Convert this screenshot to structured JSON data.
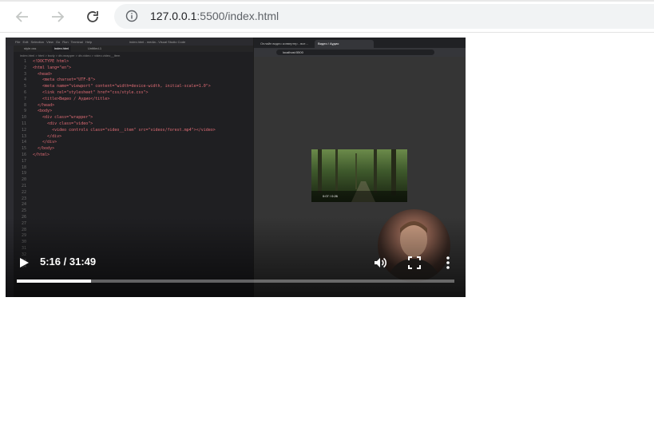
{
  "browser": {
    "url_host": "127.0.0.1",
    "url_rest": ":5500/index.html"
  },
  "vscode": {
    "menu": "File Edit Selection View Go Run Terminal Help",
    "window_title": "index.html - media - Visual Studio Code",
    "tabs": [
      "style.css",
      "index.html",
      "Untitled-1"
    ],
    "breadcrumb": "index.html > html > body > div.wrapper > div.video > video.video__item",
    "code_lines": [
      "<!DOCTYPE html>",
      "<html lang=\"en\">",
      "  <head>",
      "    <meta charset=\"UTF-8\">",
      "    <meta name=\"viewport\" content=\"width=device-width, initial-scale=1.0\">",
      "    <link rel=\"stylesheet\" href=\"css/style.css\">",
      "    <title>Видео / Аудио</title>",
      "  </head>",
      "  <body>",
      "    <div class=\"wrapper\">",
      "      <div class=\"video\">",
      "        <video controls class=\"video__item\" src=\"videos/forest.mp4\"></video>",
      "      </div>",
      "    </div>",
      "  </body>",
      "</html>",
      "",
      "",
      "",
      "",
      "",
      "",
      "",
      "",
      "",
      "",
      "",
      "",
      "",
      "",
      "",
      "",
      "",
      ""
    ]
  },
  "preview": {
    "tabs": [
      "Онлайн видео конвертер - все...",
      "Видео / Аудио"
    ],
    "url": "localhost:5500",
    "time": "0:07 / 0:26"
  },
  "player": {
    "time": "5:16 / 31:49",
    "progress": 0.17
  }
}
